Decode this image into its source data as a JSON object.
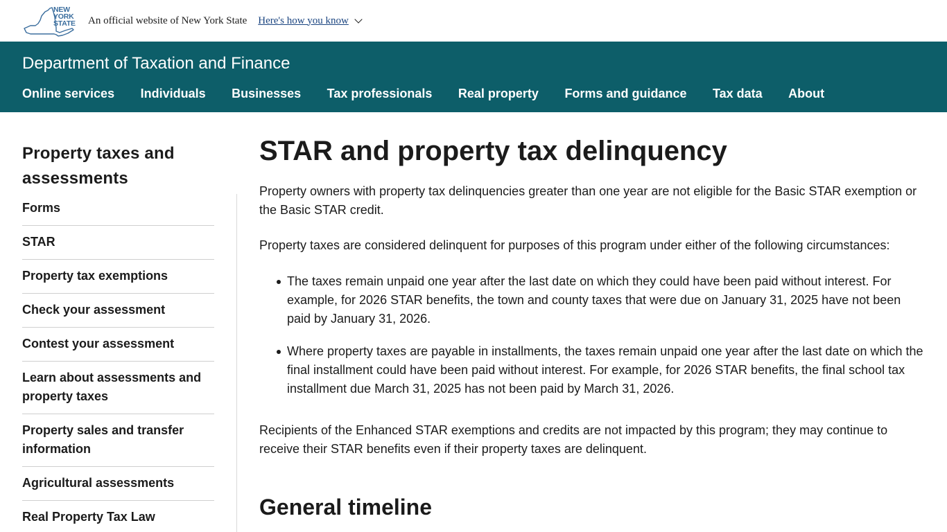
{
  "banner": {
    "logo_text": [
      "NEW",
      "YORK",
      "STATE"
    ],
    "official_text": "An official website of New York State",
    "how_know_label": "Here's how you know"
  },
  "header": {
    "dept_title": "Department of Taxation and Finance",
    "nav": [
      {
        "label": "Online services"
      },
      {
        "label": "Individuals"
      },
      {
        "label": "Businesses"
      },
      {
        "label": "Tax professionals"
      },
      {
        "label": "Real property"
      },
      {
        "label": "Forms and guidance"
      },
      {
        "label": "Tax data"
      },
      {
        "label": "About"
      }
    ]
  },
  "sidebar": {
    "title": "Property taxes and assessments",
    "items": [
      {
        "label": "Forms"
      },
      {
        "label": "STAR"
      },
      {
        "label": "Property tax exemptions"
      },
      {
        "label": "Check your assessment"
      },
      {
        "label": "Contest your assessment"
      },
      {
        "label": "Learn about assessments and property taxes"
      },
      {
        "label": "Property sales and transfer information"
      },
      {
        "label": "Agricultural assessments"
      },
      {
        "label": "Real Property Tax Law"
      }
    ]
  },
  "main": {
    "title": "STAR and property tax delinquency",
    "para1": "Property owners with property tax delinquencies greater than one year are not eligible for the Basic STAR exemption or the Basic STAR credit.",
    "para2": "Property taxes are considered delinquent for purposes of this program under either of the following circumstances:",
    "bullets": [
      "The taxes remain unpaid one year after the last date on which they could have been paid without interest. For example, for 2026 STAR benefits, the town and county taxes that were due on January 31, 2025 have not been paid by January 31, 2026.",
      "Where property taxes are payable in installments, the taxes remain unpaid one year after the last date on which the final installment could have been paid without interest. For example, for 2026 STAR benefits, the final school tax installment due March 31, 2025 has not been paid by March 31, 2026."
    ],
    "para3": "Recipients of the Enhanced STAR exemptions and credits are not impacted by this program; they may continue to receive their STAR benefits even if their property taxes are delinquent.",
    "section_title": "General timeline"
  },
  "colors": {
    "header_bg": "#0d5e69",
    "link": "#1a4480",
    "logo": "#3b6e9e"
  }
}
